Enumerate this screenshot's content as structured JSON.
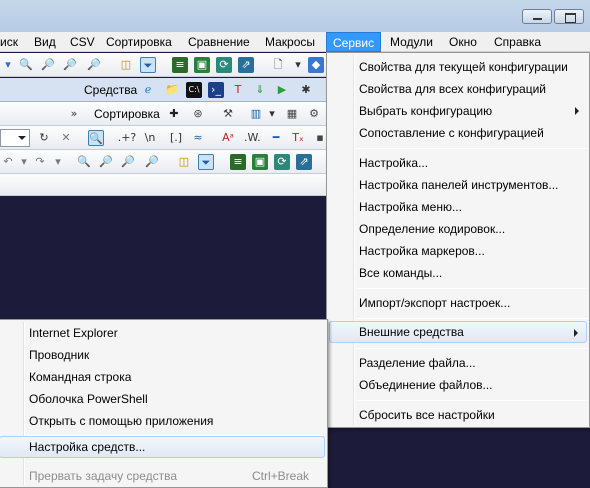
{
  "menubar": {
    "items": [
      "иск",
      "Вид",
      "CSV",
      "Сортировка",
      "Сравнение",
      "Макросы",
      "Сервис",
      "Модули",
      "Окно",
      "Справка"
    ],
    "active": "Сервис"
  },
  "toolbar2": {
    "label": "Средства"
  },
  "toolbar3": {
    "label": "Сортировка"
  },
  "service_menu": {
    "items": [
      "Свойства для текущей конфигурации",
      "Свойства для всех конфигураций",
      "Выбрать конфигурацию",
      "Сопоставление с конфигурацией",
      "Настройка...",
      "Настройка панелей инструментов...",
      "Настройка меню...",
      "Определение кодировок...",
      "Настройка маркеров...",
      "Все команды...",
      "Импорт/экспорт настроек...",
      "Внешние средства",
      "Разделение файла...",
      "Объединение файлов...",
      "Сбросить все настройки"
    ]
  },
  "tools_submenu": {
    "items": [
      "Internet Explorer",
      "Проводник",
      "Командная строка",
      "Оболочка PowerShell",
      "Открыть с помощью приложения",
      "Настройка средств...",
      "Прервать задачу средства"
    ],
    "shortcut": "Ctrl+Break"
  },
  "icons": {
    "find": "magnifier-icon",
    "filter": "filter-icon",
    "bug": "bug-icon",
    "regex": ".+?",
    "newline": "\\n",
    "brackets": "[.]",
    "approx": "≈"
  }
}
